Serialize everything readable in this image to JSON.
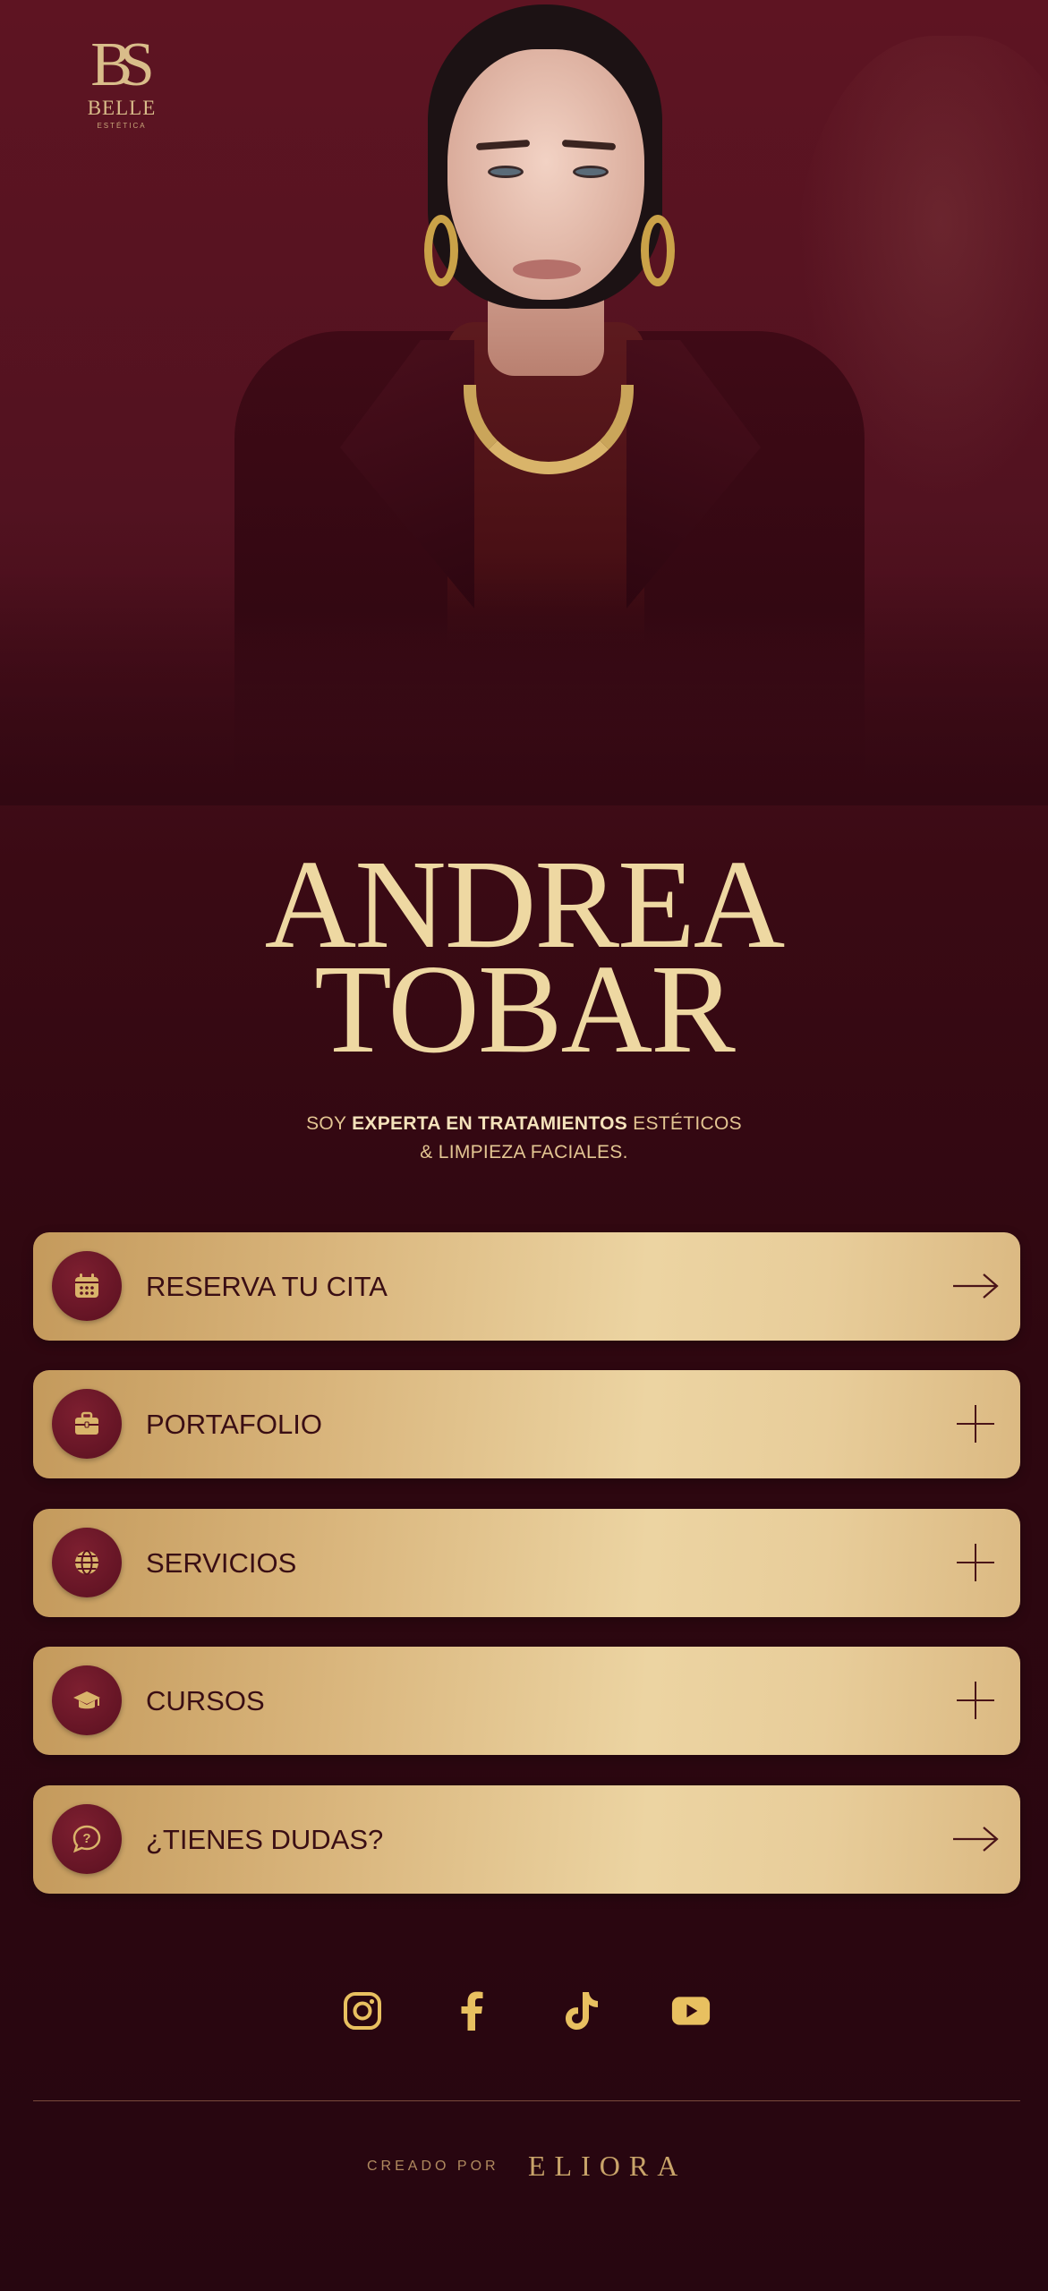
{
  "logo": {
    "mark": "BS",
    "name": "BELLE",
    "sub": "ESTÉTICA"
  },
  "hero": {
    "first_name": "ANDREA",
    "last_name": "TOBAR"
  },
  "tagline": {
    "part1": "SOY ",
    "bold": "EXPERTA EN TRATAMIENTOS",
    "part2": " ESTÉTICOS",
    "line2": "& LIMPIEZA FACIALES."
  },
  "buttons": [
    {
      "label": "RESERVA TU CITA",
      "icon": "calendar-icon",
      "action": "arrow-right-icon"
    },
    {
      "label": "PORTAFOLIO",
      "icon": "briefcase-icon",
      "action": "plus-icon"
    },
    {
      "label": "SERVICIOS",
      "icon": "globe-icon",
      "action": "plus-icon"
    },
    {
      "label": "CURSOS",
      "icon": "graduation-cap-icon",
      "action": "plus-icon"
    },
    {
      "label": "¿TIENES DUDAS?",
      "icon": "question-icon",
      "action": "arrow-right-icon"
    }
  ],
  "social": [
    "instagram-icon",
    "facebook-icon",
    "tiktok-icon",
    "youtube-icon"
  ],
  "footer": {
    "created_by": "CREADO POR",
    "brand": "ELIORA"
  },
  "colors": {
    "gold": "#e8cf9a",
    "burgundy": "#5a1020",
    "background": "#2e0710"
  }
}
